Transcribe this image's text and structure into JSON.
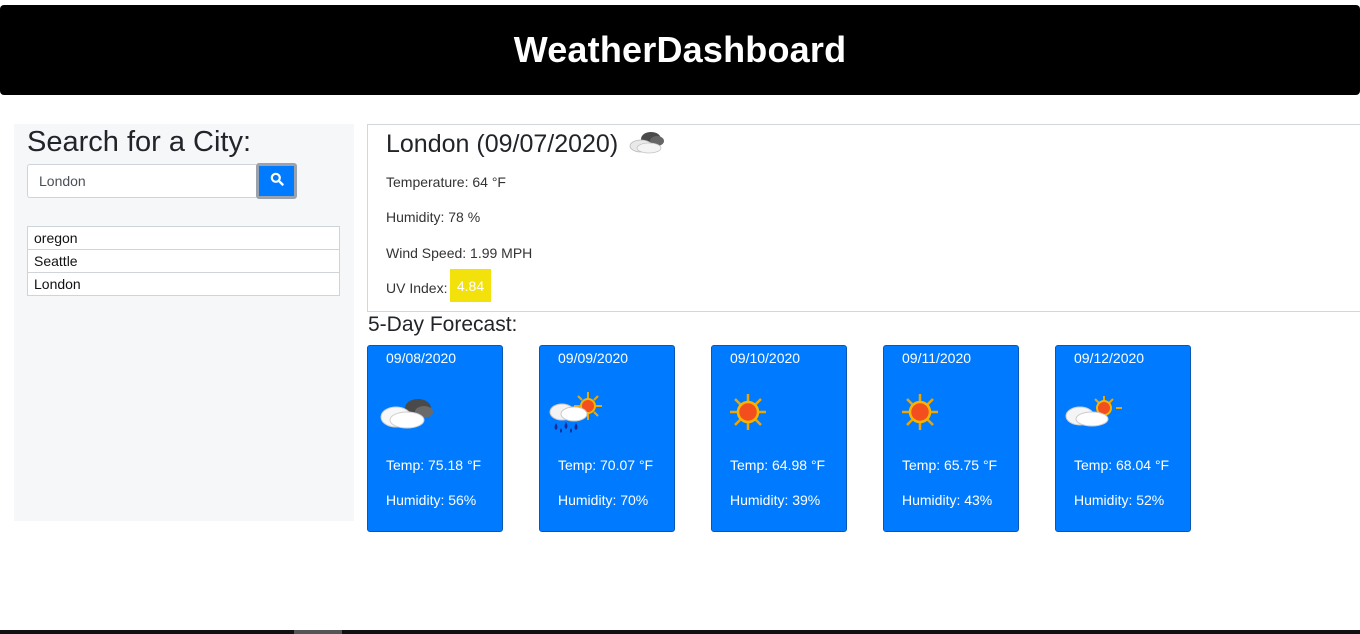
{
  "header": {
    "title": "WeatherDashboard"
  },
  "search": {
    "heading": "Search for a City:",
    "input_value": "London",
    "button_icon": "search-icon"
  },
  "history": [
    {
      "label": "oregon"
    },
    {
      "label": "Seattle"
    },
    {
      "label": "London"
    }
  ],
  "current": {
    "title": "London (09/07/2020)",
    "icon": "cloudy-icon",
    "temperature": "Temperature: 64 °F",
    "humidity": "Humidity: 78 %",
    "wind": "Wind Speed: 1.99 MPH",
    "uv_label": "UV Index:",
    "uv_value": "4.84",
    "uv_color": "#f2e10b"
  },
  "forecast": {
    "heading": "5-Day Forecast:",
    "accent": "#007bff",
    "days": [
      {
        "date": "09/08/2020",
        "icon": "partly-cloudy-icon",
        "temp": "Temp: 75.18 °F",
        "humidity": "Humidity: 56%"
      },
      {
        "date": "09/09/2020",
        "icon": "rain-sun-icon",
        "temp": "Temp: 70.07 °F",
        "humidity": "Humidity: 70%"
      },
      {
        "date": "09/10/2020",
        "icon": "sun-icon",
        "temp": "Temp: 64.98 °F",
        "humidity": "Humidity: 39%"
      },
      {
        "date": "09/11/2020",
        "icon": "sun-icon",
        "temp": "Temp: 65.75 °F",
        "humidity": "Humidity: 43%"
      },
      {
        "date": "09/12/2020",
        "icon": "sun-behind-cloud-icon",
        "temp": "Temp: 68.04 °F",
        "humidity": "Humidity: 52%"
      }
    ]
  }
}
